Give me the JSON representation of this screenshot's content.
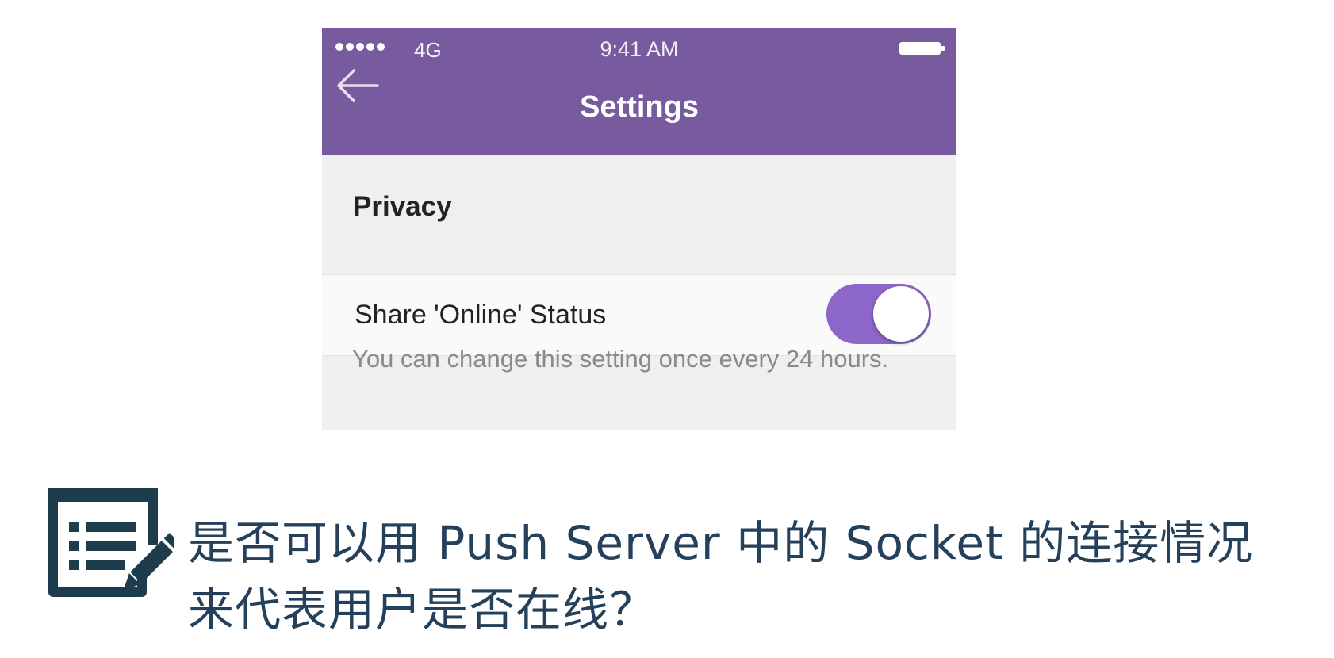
{
  "phone": {
    "status_bar": {
      "signal_dots": 5,
      "carrier": "4G",
      "time": "9:41 AM",
      "battery_icon": "battery-full-icon"
    },
    "nav": {
      "back_icon": "arrow-left-icon",
      "title": "Settings"
    },
    "section": {
      "title": "Privacy"
    },
    "setting": {
      "label": "Share 'Online' Status",
      "toggle_on": true
    },
    "footer_note": "You can change this setting once every 24 hours."
  },
  "question": {
    "icon": "note-edit-icon",
    "line1": "是否可以用 Push Server 中的 Socket 的连接情况",
    "line2": "来代表用户是否在线？"
  },
  "colors": {
    "nav_purple": "#775b9e",
    "toggle_purple": "#8d66c9",
    "question_text": "#24405a",
    "icon_dark": "#1d3d4c"
  }
}
